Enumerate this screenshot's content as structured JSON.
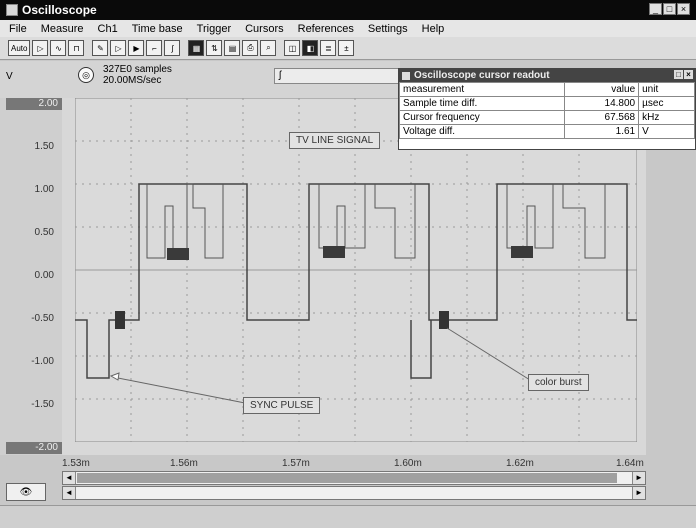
{
  "window": {
    "title": "Oscilloscope"
  },
  "menu": [
    "File",
    "Measure",
    "Ch1",
    "Time base",
    "Trigger",
    "Cursors",
    "References",
    "Settings",
    "Help"
  ],
  "toolbar": {
    "auto_label": "Auto",
    "buttons": [
      "run",
      "single",
      "hold",
      "zoom",
      "cursor",
      "display",
      "calc"
    ]
  },
  "acquisition": {
    "samples": "327E0 samples",
    "rate": "20.00MS/sec"
  },
  "y_axis": {
    "unit": "V",
    "top": "2.00",
    "bottom": "-2.00",
    "ticks": [
      "1.50",
      "1.00",
      "0.50",
      "0.00",
      "-0.50",
      "-1.00",
      "-1.50"
    ]
  },
  "x_axis": {
    "ticks": [
      "1.53m",
      "1.56m",
      "1.57m",
      "1.60m",
      "1.62m",
      "1.64m"
    ]
  },
  "annotations": {
    "tv_signal": "TV LINE SIGNAL",
    "sync_pulse": "SYNC PULSE",
    "color_burst": "color burst"
  },
  "cursor_readout": {
    "title": "Oscilloscope cursor readout",
    "headers": [
      "measurement",
      "value",
      "unit"
    ],
    "rows": [
      {
        "measurement": "Sample time diff.",
        "value": "14.800",
        "unit": "µsec"
      },
      {
        "measurement": "Cursor frequency",
        "value": "67.568",
        "unit": "kHz"
      },
      {
        "measurement": "Voltage diff.",
        "value": "1.61",
        "unit": "V"
      }
    ]
  },
  "trace": {
    "color": "#444444",
    "highlight": "#333333"
  }
}
